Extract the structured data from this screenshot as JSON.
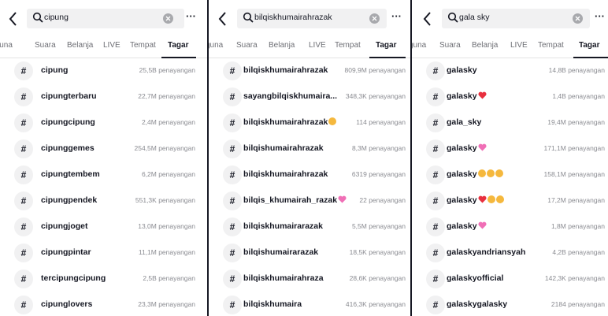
{
  "panels": [
    {
      "query": "cipung",
      "tabs": [
        "juna",
        "Suara",
        "Belanja",
        "LIVE",
        "Tempat",
        "Tagar"
      ],
      "active_tab": "Tagar",
      "rows": [
        {
          "tag": "cipung",
          "views": "25,5B penayangan"
        },
        {
          "tag": "cipungterbaru",
          "views": "22,7M penayangan"
        },
        {
          "tag": "cipungcipung",
          "views": "2,4M penayangan"
        },
        {
          "tag": "cipunggemes",
          "views": "254,5M penayangan"
        },
        {
          "tag": "cipungtembem",
          "views": "6,2M penayangan"
        },
        {
          "tag": "cipungpendek",
          "views": "551,3K penayangan"
        },
        {
          "tag": "cipungjoget",
          "views": "13,0M penayangan"
        },
        {
          "tag": "cipungpintar",
          "views": "11,1M penayangan"
        },
        {
          "tag": "tercipungcipung",
          "views": "2,5B penayangan"
        },
        {
          "tag": "cipunglovers",
          "views": "23,3M penayangan"
        }
      ]
    },
    {
      "query": "bilqiskhumairahrazak",
      "tabs": [
        "guna",
        "Suara",
        "Belanja",
        "LIVE",
        "Tempat",
        "Tagar"
      ],
      "active_tab": "Tagar",
      "rows": [
        {
          "tag": "bilqiskhumairahrazak",
          "views": "809,9M penayangan"
        },
        {
          "tag": "sayangbilqiskhumaira...",
          "views": "348,3K penayangan"
        },
        {
          "tag": "bilqiskhumairahrazak",
          "views": "114 penayangan"
        },
        {
          "tag": "bilqishumairahrazak",
          "views": "8,3M penayangan"
        },
        {
          "tag": "bilqiskhumairahrazak",
          "views": "6319 penayangan"
        },
        {
          "tag": "bilqis_khumairah_razak",
          "views": "22 penayangan"
        },
        {
          "tag": "bilqiskhumairarazak",
          "views": "5,5M penayangan"
        },
        {
          "tag": "bilqishumairarazak",
          "views": "18,5K penayangan"
        },
        {
          "tag": "bilqiskhumairahraza",
          "views": "28,6K penayangan"
        },
        {
          "tag": "bilqiskhumaira",
          "views": "416,3K penayangan"
        }
      ]
    },
    {
      "query": "gala sky",
      "tabs": [
        "guna",
        "Suara",
        "Belanja",
        "LIVE",
        "Tempat",
        "Tagar"
      ],
      "active_tab": "Tagar",
      "rows": [
        {
          "tag": "galasky",
          "views": "14,8B penayangan"
        },
        {
          "tag": "galasky",
          "views": "1,4B penayangan"
        },
        {
          "tag": "gala_sky",
          "views": "19,4M penayangan"
        },
        {
          "tag": "galasky",
          "views": "171,1M penayangan"
        },
        {
          "tag": "galasky",
          "views": "158,1M penayangan"
        },
        {
          "tag": "galasky",
          "views": "17,2M penayangan"
        },
        {
          "tag": "galasky",
          "views": "1,8M penayangan"
        },
        {
          "tag": "galaskyandriansyah",
          "views": "4,2B penayangan"
        },
        {
          "tag": "galaskyofficial",
          "views": "142,3K penayangan"
        },
        {
          "tag": "galaskygalasky",
          "views": "2184 penayangan"
        }
      ]
    }
  ],
  "icons": {
    "back": "chevron-left-icon",
    "search": "search-icon",
    "clear": "clear-icon",
    "more": "more-icon",
    "hashtag": "hashtag-icon"
  },
  "colors": {
    "text": "#161823",
    "muted": "#8a8b91",
    "search_bg": "#f1f1f2",
    "heart": "#e8303f",
    "pink_heart": "#f06fb6",
    "smiley": "#f5b83d"
  }
}
